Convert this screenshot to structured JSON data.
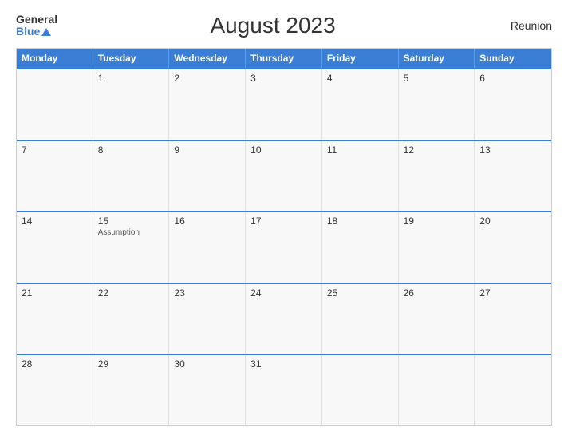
{
  "header": {
    "logo_general": "General",
    "logo_blue": "Blue",
    "title": "August 2023",
    "region": "Reunion"
  },
  "calendar": {
    "days_of_week": [
      "Monday",
      "Tuesday",
      "Wednesday",
      "Thursday",
      "Friday",
      "Saturday",
      "Sunday"
    ],
    "weeks": [
      [
        {
          "day": "",
          "empty": true
        },
        {
          "day": "1"
        },
        {
          "day": "2"
        },
        {
          "day": "3"
        },
        {
          "day": "4"
        },
        {
          "day": "5"
        },
        {
          "day": "6"
        }
      ],
      [
        {
          "day": "7"
        },
        {
          "day": "8"
        },
        {
          "day": "9"
        },
        {
          "day": "10"
        },
        {
          "day": "11"
        },
        {
          "day": "12"
        },
        {
          "day": "13"
        }
      ],
      [
        {
          "day": "14"
        },
        {
          "day": "15",
          "event": "Assumption"
        },
        {
          "day": "16"
        },
        {
          "day": "17"
        },
        {
          "day": "18"
        },
        {
          "day": "19"
        },
        {
          "day": "20"
        }
      ],
      [
        {
          "day": "21"
        },
        {
          "day": "22"
        },
        {
          "day": "23"
        },
        {
          "day": "24"
        },
        {
          "day": "25"
        },
        {
          "day": "26"
        },
        {
          "day": "27"
        }
      ],
      [
        {
          "day": "28"
        },
        {
          "day": "29"
        },
        {
          "day": "30"
        },
        {
          "day": "31"
        },
        {
          "day": "",
          "empty": true
        },
        {
          "day": "",
          "empty": true
        },
        {
          "day": "",
          "empty": true
        }
      ]
    ]
  }
}
